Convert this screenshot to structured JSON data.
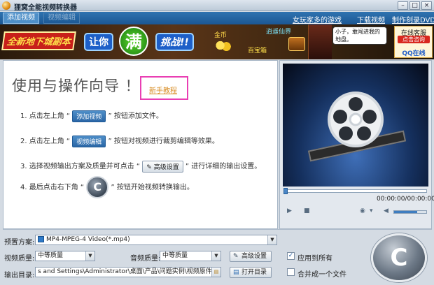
{
  "window": {
    "title": "狸窝全能视频转换器",
    "min_glyph": "–",
    "max_glyph": "□",
    "close_glyph": "×"
  },
  "menubar": {
    "tabs": [
      {
        "label": "添加视频",
        "state": "active"
      },
      {
        "label": "视频编辑",
        "state": "disabled"
      }
    ],
    "links": [
      "女玩家多的游戏",
      "下载视频",
      "制作刻录DVD"
    ]
  },
  "banner": {
    "text_red": "全新地下城副本",
    "text_blue": "让你",
    "text_big": "满级",
    "text_blue2": "挑战!!",
    "gold": "金币",
    "game_name": "逍遥仙界",
    "treasure": "百宝箱",
    "speech": "小子，敢闯进我的地盘。"
  },
  "qq": {
    "line1": "在线客服",
    "line2": "点击咨询",
    "line3": "QQ在线"
  },
  "guide": {
    "title": "使用与操作向导 ！",
    "tutorial_link": "新手教程",
    "step1_pre": "1. 点击左上角",
    "step1_btn": "添加视频",
    "step1_post": "按钮添加文件。",
    "step2_pre": "2. 点击左上角",
    "step2_btn": "视频编辑",
    "step2_post": "按钮对视频进行裁剪编辑等效果。",
    "step3_pre": "3. 选择视频输出方案及质量并可点击",
    "step3_btn": "高级设置",
    "step3_post": "进行详细的输出设置。",
    "step4_pre": "4. 最后点击右下角",
    "step4_post": "按钮开始视频转换输出。"
  },
  "player": {
    "time": "00:00:00/00:00:00",
    "play_glyph": "▶",
    "stop_glyph": "■",
    "camera_glyph": "◉",
    "dropdown_glyph": "▾",
    "volume_glyph": "◀",
    "volume_level": 0.72,
    "seek_position": 0
  },
  "settings": {
    "preset_label": "预置方案:",
    "preset_value": "MP4-MPEG-4 Video(*.mp4)",
    "video_quality_label": "视频质量:",
    "video_quality_value": "中等质量",
    "audio_quality_label": "音频质量:",
    "audio_quality_value": "中等质量",
    "advanced_button": "高级设置",
    "apply_all_label": "应用到所有",
    "apply_all_checked": true,
    "output_label": "输出目录:",
    "output_path": "s and Settings\\Administrator\\桌面\\产品\\问题实例\\视频原件\\转换",
    "open_dir_button": "打开目录",
    "merge_label": "合并成一个文件",
    "merge_checked": false,
    "dropdown_arrow": "▼",
    "check_mark": "✓",
    "folder_glyph": "▤",
    "wrench_glyph": "✎",
    "convert_glyph": "C"
  }
}
